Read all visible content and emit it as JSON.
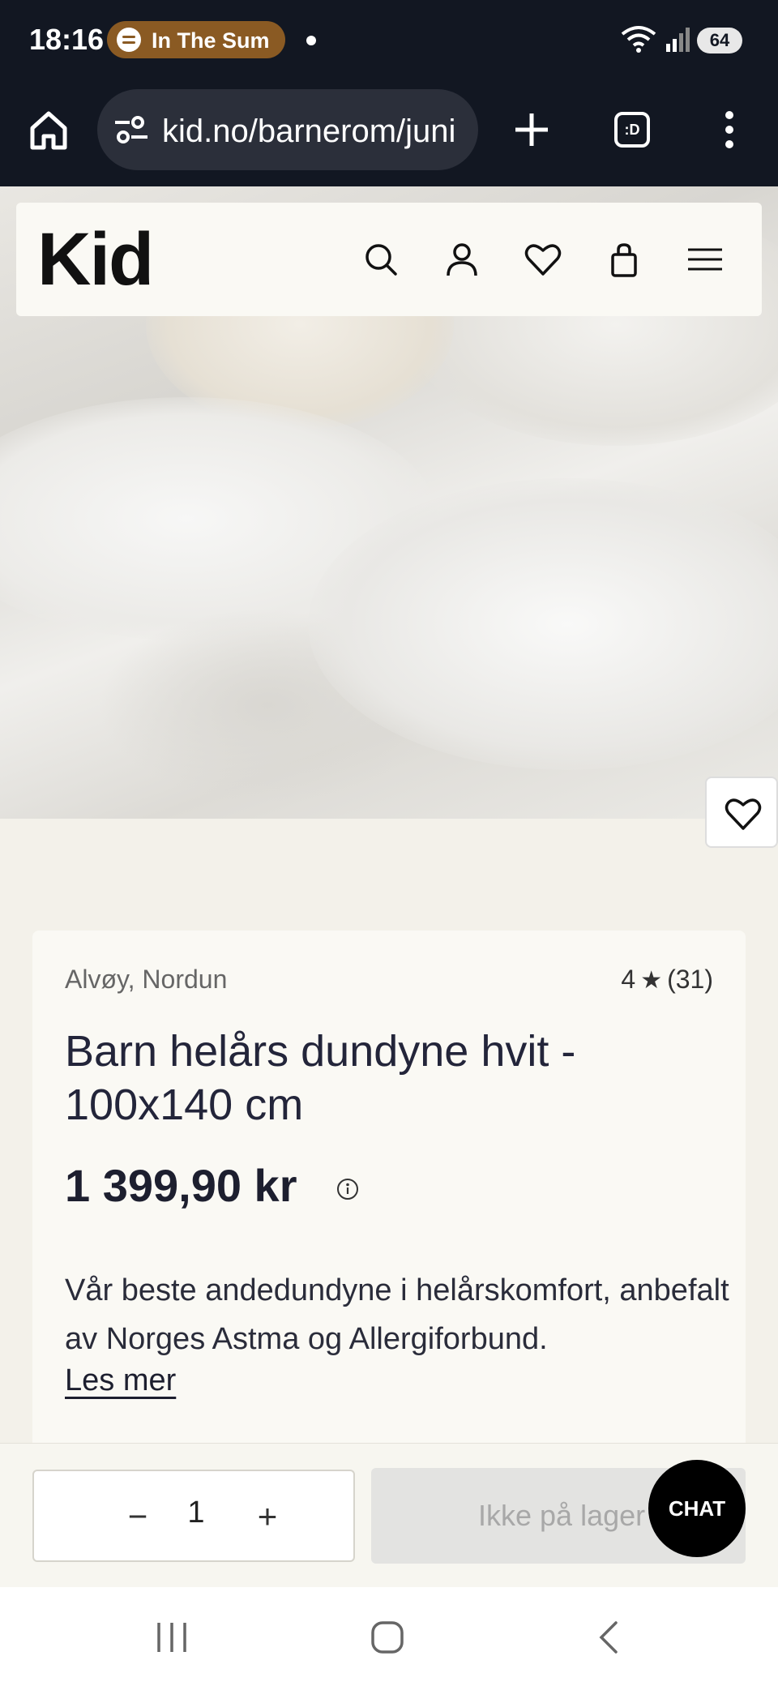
{
  "status_bar": {
    "time": "18:16",
    "media_label": "In The Sum",
    "battery": "64"
  },
  "browser": {
    "url": "kid.no/barnerom/juni",
    "tabs_label": ":D"
  },
  "site": {
    "logo": "Kid",
    "icons": [
      "search-icon",
      "account-icon",
      "wishlist-icon",
      "cart-icon",
      "menu-icon"
    ]
  },
  "product": {
    "brand": "Alvøy, Nordun",
    "rating_value": "4",
    "rating_star": "★",
    "rating_count": "(31)",
    "title": "Barn helårs dundyne hvit - 100x140 cm",
    "price": "1 399,90 kr",
    "description": "Vår beste andedundyne i helårskomfort, anbefalt av Norges Astma og Allergiforbund.",
    "read_more": "Les mer"
  },
  "buy_bar": {
    "quantity": "1",
    "minus_label": "−",
    "plus_label": "+",
    "stock_label": "Ikke på lager",
    "chat_label": "CHAT"
  },
  "colors": {
    "status_bg": "#121722",
    "page_bg": "#f3f1ea",
    "card_bg": "#faf9f4",
    "chat_bg": "#000000",
    "media_pill": "#8a5a23"
  }
}
